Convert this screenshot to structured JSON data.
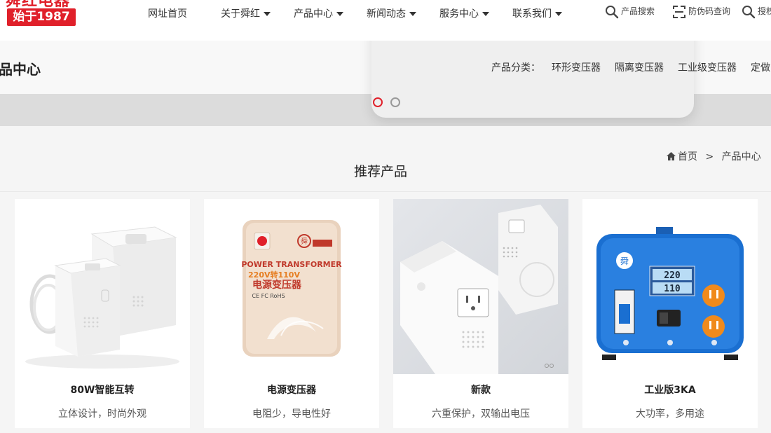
{
  "logo": {
    "top_text": "舜红电器",
    "box_text": "始于1987"
  },
  "nav": [
    {
      "label": "网址首页",
      "dropdown": false
    },
    {
      "label": "关于舜红",
      "dropdown": true
    },
    {
      "label": "产品中心",
      "dropdown": true
    },
    {
      "label": "新闻动态",
      "dropdown": true
    },
    {
      "label": "服务中心",
      "dropdown": true
    },
    {
      "label": "联系我们",
      "dropdown": true
    }
  ],
  "tools": {
    "product_search": "产品搜索",
    "anti_fake": "防伪码查询",
    "auth": "授权"
  },
  "banner": {
    "title": "品中心",
    "category_label": "产品分类：",
    "categories": [
      "环形变压器",
      "隔离变压器",
      "工业级变压器",
      "定做"
    ]
  },
  "section": {
    "title": "推荐产品",
    "breadcrumb": {
      "home": "首页",
      "separator": ">",
      "current": "产品中心"
    }
  },
  "products": [
    {
      "name": "80W智能互转",
      "desc": "立体设计，时尚外观"
    },
    {
      "name": "电源变压器",
      "desc": "电阻少，导电性好"
    },
    {
      "name": "新款",
      "desc": "六重保护，双输出电压"
    },
    {
      "name": "工业版3KA",
      "desc": "大功率，多用途"
    }
  ],
  "product_images": {
    "power_transformer_text": "POWER TRANSFORMER",
    "power_transformer_sub": "220V转110V",
    "power_transformer_cn": "电源变压器",
    "power_transformer_cert": "CE FC RoHS",
    "meter_top": "220",
    "meter_bottom": "110"
  },
  "colors": {
    "brand_red": "#e0202a",
    "industrial_blue": "#1a6fd1",
    "outlet_orange": "#f08a1c"
  }
}
